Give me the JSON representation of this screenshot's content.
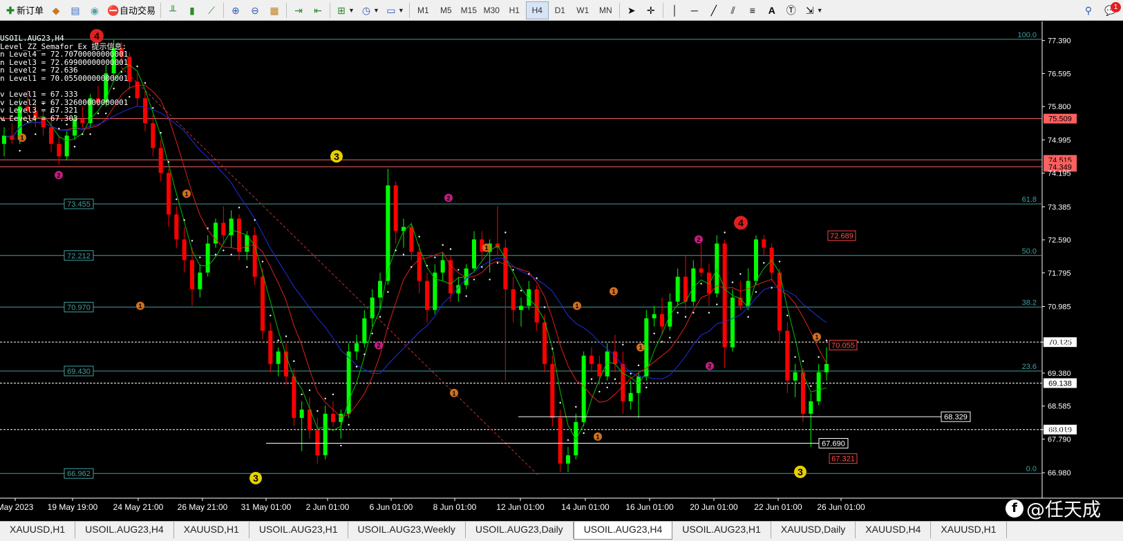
{
  "toolbar": {
    "new_order": "新订单",
    "auto_trading": "自动交易",
    "timeframes": [
      "M1",
      "M5",
      "M15",
      "M30",
      "H1",
      "H4",
      "D1",
      "W1",
      "MN"
    ],
    "active_timeframe": "H4",
    "alert_count": "1"
  },
  "info_box": {
    "symbol": "USOIL.AUG23,H4",
    "indicator": "Level_ZZ_Semafor_Ex 提示信息:",
    "lines": [
      "n Level4 = 72.70700000000001",
      "n Level3 = 72.69900000000001",
      "n Level2 = 72.636",
      "n Level1 = 70.05500000000001",
      "",
      "v Level1 = 67.333",
      "v Level2 = 67.32600000000001",
      "v Level3 = 67.321",
      "v Level4 = 67.303"
    ]
  },
  "chart_data": {
    "type": "candlestick",
    "symbol": "USOIL.AUG23,H4",
    "background": "#000000",
    "bull_color": "#00ff00",
    "bear_color": "#ff0000",
    "ylim": [
      66.6,
      77.85
    ],
    "price_axis_ticks": [
      "77.390",
      "76.595",
      "75.800",
      "74.995",
      "74.195",
      "73.385",
      "72.590",
      "71.795",
      "70.985",
      "70.125",
      "69.380",
      "68.585",
      "68.019",
      "67.790",
      "66.980"
    ],
    "time_axis_ticks": [
      "May 2023",
      "19 May 19:00",
      "24 May 21:00",
      "26 May 21:00",
      "31 May 01:00",
      "2 Jun 01:00",
      "6 Jun 01:00",
      "8 Jun 01:00",
      "12 Jun 01:00",
      "14 Jun 01:00",
      "16 Jun 01:00",
      "20 Jun 01:00",
      "22 Jun 01:00",
      "26 Jun 01:00"
    ],
    "fibonacci_levels": [
      {
        "pct": "100.0",
        "price": 77.42
      },
      {
        "pct": "61.8",
        "price": 73.455
      },
      {
        "pct": "50.0",
        "price": 72.212
      },
      {
        "pct": "38.2",
        "price": 70.97
      },
      {
        "pct": "23.6",
        "price": 69.43
      },
      {
        "pct": "0.0",
        "price": 66.962
      }
    ],
    "fib_left_labels": [
      "73.455",
      "72.212",
      "70.970",
      "69.430",
      "66.962"
    ],
    "horizontal_lines": [
      {
        "price": 75.509,
        "label": "75.509",
        "color": "#ff6060"
      },
      {
        "price": 74.515,
        "label": "74.515",
        "color": "#ff6060"
      },
      {
        "price": 74.349,
        "label": "74.349",
        "color": "#ff6060"
      },
      {
        "price": 70.125,
        "label": "70.125",
        "color": "#ffffff"
      },
      {
        "price": 69.138,
        "label": "69.138",
        "color": "#ffffff"
      },
      {
        "price": 68.019,
        "label": "68.019",
        "color": "#ffffff"
      }
    ],
    "price_boxes": [
      {
        "price": 68.329,
        "label": "68.329"
      },
      {
        "price": 67.69,
        "label": "67.690"
      }
    ],
    "red_boxes": [
      {
        "price": 72.689,
        "label": "72.689"
      },
      {
        "price": 70.055,
        "label": "70.055"
      },
      {
        "price": 67.321,
        "label": "67.321"
      }
    ],
    "semafor_marks": [
      "1",
      "2",
      "3",
      "4"
    ],
    "candles": [
      [
        74.9,
        75.3,
        74.6,
        75.1
      ],
      [
        75.1,
        75.4,
        74.9,
        75.0
      ],
      [
        75.0,
        76.0,
        74.9,
        75.8
      ],
      [
        75.8,
        76.2,
        75.6,
        75.7
      ],
      [
        75.7,
        75.9,
        75.3,
        75.5
      ],
      [
        75.5,
        75.7,
        75.1,
        75.3
      ],
      [
        75.3,
        75.5,
        74.7,
        74.9
      ],
      [
        74.9,
        75.1,
        74.4,
        74.6
      ],
      [
        74.6,
        75.2,
        74.5,
        75.1
      ],
      [
        75.1,
        75.6,
        75.0,
        75.5
      ],
      [
        75.5,
        75.8,
        75.3,
        75.4
      ],
      [
        75.4,
        76.1,
        75.3,
        76.0
      ],
      [
        76.0,
        76.3,
        75.8,
        75.9
      ],
      [
        75.9,
        76.8,
        75.8,
        76.6
      ],
      [
        76.6,
        77.4,
        76.4,
        77.2
      ],
      [
        77.2,
        77.35,
        76.8,
        77.0
      ],
      [
        77.0,
        77.1,
        76.2,
        76.4
      ],
      [
        76.4,
        76.6,
        75.8,
        76.0
      ],
      [
        76.0,
        76.2,
        75.2,
        75.4
      ],
      [
        75.4,
        75.6,
        74.6,
        74.8
      ],
      [
        74.8,
        75.0,
        74.0,
        74.2
      ],
      [
        74.2,
        74.3,
        72.9,
        73.2
      ],
      [
        73.2,
        73.4,
        72.4,
        72.6
      ],
      [
        72.6,
        72.9,
        71.8,
        72.1
      ],
      [
        72.1,
        72.4,
        71.0,
        71.4
      ],
      [
        71.4,
        72.0,
        71.2,
        71.8
      ],
      [
        71.8,
        72.7,
        71.7,
        72.5
      ],
      [
        72.5,
        73.1,
        72.4,
        73.0
      ],
      [
        73.0,
        73.4,
        72.5,
        72.7
      ],
      [
        72.7,
        73.3,
        72.4,
        73.1
      ],
      [
        73.1,
        73.2,
        72.1,
        72.3
      ],
      [
        72.3,
        72.8,
        72.1,
        72.7
      ],
      [
        72.7,
        72.9,
        71.5,
        71.7
      ],
      [
        71.7,
        71.9,
        70.2,
        70.4
      ],
      [
        70.4,
        70.6,
        69.4,
        69.6
      ],
      [
        69.6,
        70.0,
        69.3,
        69.9
      ],
      [
        69.9,
        70.1,
        69.1,
        69.3
      ],
      [
        69.3,
        69.5,
        68.1,
        68.3
      ],
      [
        68.3,
        68.7,
        67.5,
        68.5
      ],
      [
        68.5,
        68.8,
        67.8,
        68.0
      ],
      [
        68.0,
        68.3,
        67.2,
        67.4
      ],
      [
        67.4,
        68.6,
        67.3,
        68.4
      ],
      [
        68.4,
        68.7,
        68.1,
        68.2
      ],
      [
        68.2,
        68.5,
        67.8,
        68.4
      ],
      [
        68.4,
        70.1,
        68.3,
        69.9
      ],
      [
        69.9,
        70.3,
        69.7,
        70.1
      ],
      [
        70.1,
        70.9,
        70.0,
        70.7
      ],
      [
        70.7,
        71.4,
        70.5,
        71.2
      ],
      [
        71.2,
        71.8,
        70.9,
        71.6
      ],
      [
        71.6,
        74.3,
        71.5,
        73.9
      ],
      [
        73.9,
        74.0,
        72.5,
        72.8
      ],
      [
        72.8,
        73.1,
        72.4,
        72.9
      ],
      [
        72.9,
        73.0,
        72.1,
        72.3
      ],
      [
        72.3,
        72.5,
        71.3,
        71.6
      ],
      [
        71.6,
        71.8,
        70.6,
        70.9
      ],
      [
        70.9,
        72.0,
        70.8,
        71.8
      ],
      [
        71.8,
        72.3,
        71.6,
        72.1
      ],
      [
        72.1,
        72.2,
        71.1,
        71.3
      ],
      [
        71.3,
        71.7,
        71.1,
        71.5
      ],
      [
        71.5,
        72.0,
        71.4,
        71.9
      ],
      [
        71.9,
        72.8,
        71.8,
        72.6
      ],
      [
        72.6,
        72.8,
        72.1,
        72.3
      ],
      [
        72.3,
        72.6,
        71.8,
        72.5
      ],
      [
        72.5,
        73.4,
        72.2,
        72.4
      ],
      [
        72.4,
        72.6,
        69.2,
        71.4
      ],
      [
        71.4,
        71.7,
        70.6,
        70.9
      ],
      [
        70.9,
        71.2,
        70.5,
        71.0
      ],
      [
        71.0,
        71.6,
        70.9,
        71.4
      ],
      [
        71.4,
        71.5,
        70.4,
        70.6
      ],
      [
        70.6,
        70.8,
        69.4,
        69.6
      ],
      [
        69.6,
        69.8,
        68.1,
        68.3
      ],
      [
        68.3,
        68.5,
        67.0,
        67.2
      ],
      [
        67.2,
        67.6,
        67.0,
        67.4
      ],
      [
        67.4,
        68.4,
        67.3,
        68.2
      ],
      [
        68.2,
        69.9,
        68.1,
        69.8
      ],
      [
        69.8,
        70.0,
        69.4,
        69.6
      ],
      [
        69.6,
        69.8,
        69.1,
        69.3
      ],
      [
        69.3,
        70.1,
        69.2,
        69.9
      ],
      [
        69.9,
        70.3,
        69.4,
        69.6
      ],
      [
        69.6,
        69.9,
        68.4,
        68.7
      ],
      [
        68.7,
        69.2,
        68.5,
        68.9
      ],
      [
        68.9,
        69.4,
        68.3,
        69.3
      ],
      [
        69.3,
        70.9,
        69.2,
        70.7
      ],
      [
        70.7,
        71.0,
        70.5,
        70.8
      ],
      [
        70.8,
        71.2,
        70.3,
        70.5
      ],
      [
        70.5,
        71.3,
        70.4,
        71.1
      ],
      [
        71.1,
        71.9,
        71.0,
        71.7
      ],
      [
        71.7,
        72.2,
        70.9,
        71.1
      ],
      [
        71.1,
        72.1,
        71.0,
        71.9
      ],
      [
        71.9,
        72.5,
        71.7,
        71.8
      ],
      [
        71.8,
        72.0,
        71.0,
        71.3
      ],
      [
        71.3,
        72.7,
        71.2,
        72.5
      ],
      [
        72.5,
        72.6,
        69.5,
        70.0
      ],
      [
        70.0,
        71.4,
        69.9,
        71.2
      ],
      [
        71.2,
        71.6,
        70.9,
        71.0
      ],
      [
        71.0,
        71.9,
        70.9,
        71.6
      ],
      [
        71.6,
        72.7,
        71.5,
        72.6
      ],
      [
        72.6,
        72.7,
        72.2,
        72.4
      ],
      [
        72.4,
        72.5,
        71.6,
        71.8
      ],
      [
        71.8,
        71.9,
        70.1,
        70.4
      ],
      [
        70.4,
        70.6,
        68.9,
        69.2
      ],
      [
        69.2,
        69.6,
        68.8,
        69.4
      ],
      [
        69.4,
        69.5,
        68.2,
        68.4
      ],
      [
        68.4,
        68.9,
        67.6,
        68.7
      ],
      [
        68.7,
        69.6,
        68.6,
        69.4
      ],
      [
        69.4,
        70.0,
        69.2,
        69.6
      ]
    ]
  },
  "tabs": [
    {
      "label": "XAUUSD,H1",
      "active": false
    },
    {
      "label": "USOIL.AUG23,H4",
      "active": false
    },
    {
      "label": "XAUUSD,H1",
      "active": false
    },
    {
      "label": "USOIL.AUG23,H1",
      "active": false
    },
    {
      "label": "USOIL.AUG23,Weekly",
      "active": false
    },
    {
      "label": "USOIL.AUG23,Daily",
      "active": false
    },
    {
      "label": "USOIL.AUG23,H4",
      "active": true
    },
    {
      "label": "USOIL.AUG23,H1",
      "active": false
    },
    {
      "label": "XAUUSD,Daily",
      "active": false
    },
    {
      "label": "XAUUSD,H4",
      "active": false
    },
    {
      "label": "XAUUSD,H1",
      "active": false
    }
  ],
  "watermark": "@任天成"
}
